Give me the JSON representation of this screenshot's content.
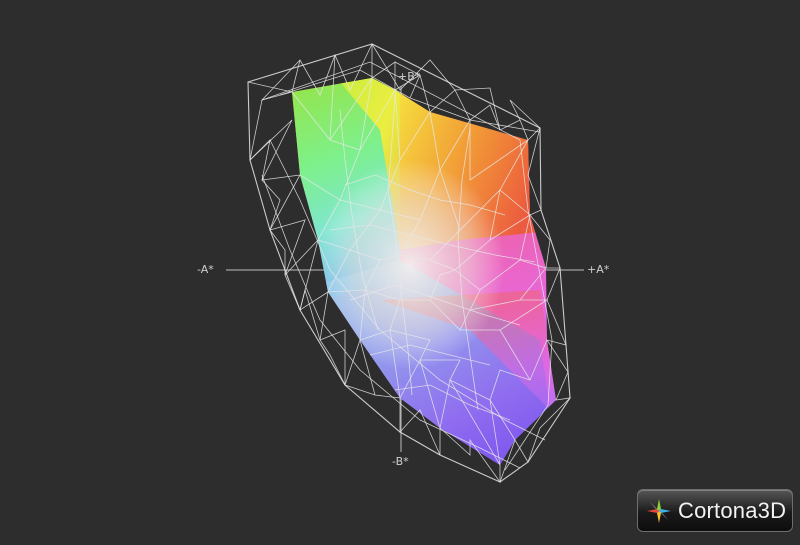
{
  "axes": {
    "neg_a": "-A*",
    "pos_a": "+A*",
    "pos_b": "+B*",
    "neg_b": "-B*"
  },
  "logo": {
    "text": "Cortona3D",
    "icon": "cortona-star-icon"
  },
  "colors": {
    "background": "#2d2d2d",
    "wireframe": "#e8e8e8",
    "axis": "#cccccc"
  }
}
